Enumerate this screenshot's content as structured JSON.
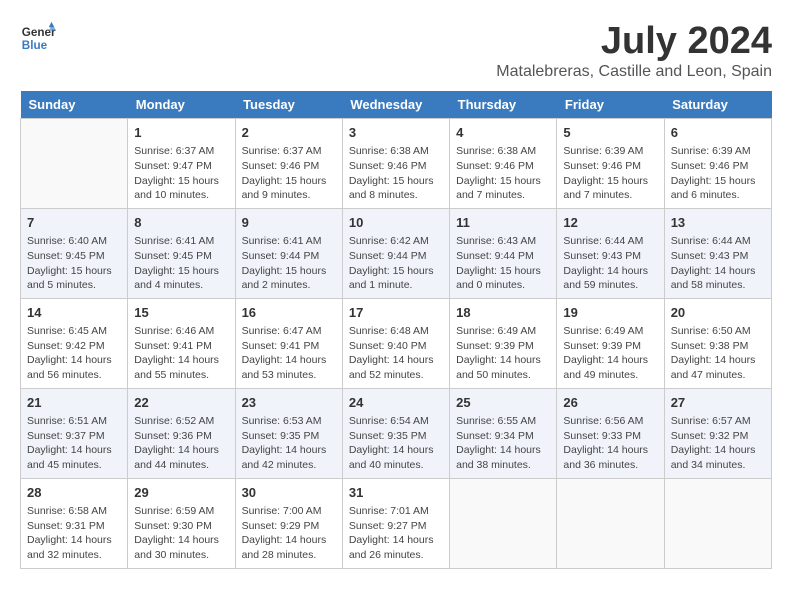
{
  "header": {
    "logo_line1": "General",
    "logo_line2": "Blue",
    "month": "July 2024",
    "location": "Matalebreras, Castille and Leon, Spain"
  },
  "weekdays": [
    "Sunday",
    "Monday",
    "Tuesday",
    "Wednesday",
    "Thursday",
    "Friday",
    "Saturday"
  ],
  "weeks": [
    [
      {
        "day": "",
        "info": ""
      },
      {
        "day": "1",
        "info": "Sunrise: 6:37 AM\nSunset: 9:47 PM\nDaylight: 15 hours\nand 10 minutes."
      },
      {
        "day": "2",
        "info": "Sunrise: 6:37 AM\nSunset: 9:46 PM\nDaylight: 15 hours\nand 9 minutes."
      },
      {
        "day": "3",
        "info": "Sunrise: 6:38 AM\nSunset: 9:46 PM\nDaylight: 15 hours\nand 8 minutes."
      },
      {
        "day": "4",
        "info": "Sunrise: 6:38 AM\nSunset: 9:46 PM\nDaylight: 15 hours\nand 7 minutes."
      },
      {
        "day": "5",
        "info": "Sunrise: 6:39 AM\nSunset: 9:46 PM\nDaylight: 15 hours\nand 7 minutes."
      },
      {
        "day": "6",
        "info": "Sunrise: 6:39 AM\nSunset: 9:46 PM\nDaylight: 15 hours\nand 6 minutes."
      }
    ],
    [
      {
        "day": "7",
        "info": "Sunrise: 6:40 AM\nSunset: 9:45 PM\nDaylight: 15 hours\nand 5 minutes."
      },
      {
        "day": "8",
        "info": "Sunrise: 6:41 AM\nSunset: 9:45 PM\nDaylight: 15 hours\nand 4 minutes."
      },
      {
        "day": "9",
        "info": "Sunrise: 6:41 AM\nSunset: 9:44 PM\nDaylight: 15 hours\nand 2 minutes."
      },
      {
        "day": "10",
        "info": "Sunrise: 6:42 AM\nSunset: 9:44 PM\nDaylight: 15 hours\nand 1 minute."
      },
      {
        "day": "11",
        "info": "Sunrise: 6:43 AM\nSunset: 9:44 PM\nDaylight: 15 hours\nand 0 minutes."
      },
      {
        "day": "12",
        "info": "Sunrise: 6:44 AM\nSunset: 9:43 PM\nDaylight: 14 hours\nand 59 minutes."
      },
      {
        "day": "13",
        "info": "Sunrise: 6:44 AM\nSunset: 9:43 PM\nDaylight: 14 hours\nand 58 minutes."
      }
    ],
    [
      {
        "day": "14",
        "info": "Sunrise: 6:45 AM\nSunset: 9:42 PM\nDaylight: 14 hours\nand 56 minutes."
      },
      {
        "day": "15",
        "info": "Sunrise: 6:46 AM\nSunset: 9:41 PM\nDaylight: 14 hours\nand 55 minutes."
      },
      {
        "day": "16",
        "info": "Sunrise: 6:47 AM\nSunset: 9:41 PM\nDaylight: 14 hours\nand 53 minutes."
      },
      {
        "day": "17",
        "info": "Sunrise: 6:48 AM\nSunset: 9:40 PM\nDaylight: 14 hours\nand 52 minutes."
      },
      {
        "day": "18",
        "info": "Sunrise: 6:49 AM\nSunset: 9:39 PM\nDaylight: 14 hours\nand 50 minutes."
      },
      {
        "day": "19",
        "info": "Sunrise: 6:49 AM\nSunset: 9:39 PM\nDaylight: 14 hours\nand 49 minutes."
      },
      {
        "day": "20",
        "info": "Sunrise: 6:50 AM\nSunset: 9:38 PM\nDaylight: 14 hours\nand 47 minutes."
      }
    ],
    [
      {
        "day": "21",
        "info": "Sunrise: 6:51 AM\nSunset: 9:37 PM\nDaylight: 14 hours\nand 45 minutes."
      },
      {
        "day": "22",
        "info": "Sunrise: 6:52 AM\nSunset: 9:36 PM\nDaylight: 14 hours\nand 44 minutes."
      },
      {
        "day": "23",
        "info": "Sunrise: 6:53 AM\nSunset: 9:35 PM\nDaylight: 14 hours\nand 42 minutes."
      },
      {
        "day": "24",
        "info": "Sunrise: 6:54 AM\nSunset: 9:35 PM\nDaylight: 14 hours\nand 40 minutes."
      },
      {
        "day": "25",
        "info": "Sunrise: 6:55 AM\nSunset: 9:34 PM\nDaylight: 14 hours\nand 38 minutes."
      },
      {
        "day": "26",
        "info": "Sunrise: 6:56 AM\nSunset: 9:33 PM\nDaylight: 14 hours\nand 36 minutes."
      },
      {
        "day": "27",
        "info": "Sunrise: 6:57 AM\nSunset: 9:32 PM\nDaylight: 14 hours\nand 34 minutes."
      }
    ],
    [
      {
        "day": "28",
        "info": "Sunrise: 6:58 AM\nSunset: 9:31 PM\nDaylight: 14 hours\nand 32 minutes."
      },
      {
        "day": "29",
        "info": "Sunrise: 6:59 AM\nSunset: 9:30 PM\nDaylight: 14 hours\nand 30 minutes."
      },
      {
        "day": "30",
        "info": "Sunrise: 7:00 AM\nSunset: 9:29 PM\nDaylight: 14 hours\nand 28 minutes."
      },
      {
        "day": "31",
        "info": "Sunrise: 7:01 AM\nSunset: 9:27 PM\nDaylight: 14 hours\nand 26 minutes."
      },
      {
        "day": "",
        "info": ""
      },
      {
        "day": "",
        "info": ""
      },
      {
        "day": "",
        "info": ""
      }
    ]
  ]
}
